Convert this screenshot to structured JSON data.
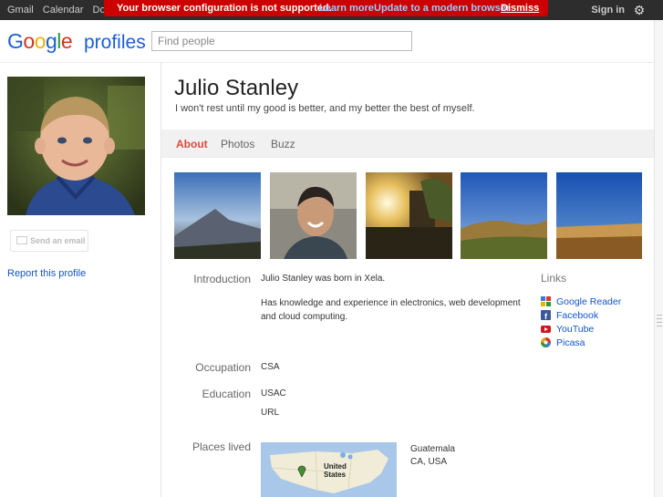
{
  "topbar": {
    "nav": [
      "Gmail",
      "Calendar",
      "Docu"
    ],
    "sign_in": "Sign in",
    "settings_icon": "gear-icon"
  },
  "warning": {
    "message": "Your browser configuration is not supported.",
    "learn_more": "Learn more",
    "update": "Update to a modern browser",
    "dismiss": "Dismiss",
    "color": "#cc0000"
  },
  "header": {
    "logo_text": "Google",
    "product": "profiles",
    "search_placeholder": "Find people"
  },
  "left": {
    "send_email": "Send an email",
    "report": "Report this profile"
  },
  "profile": {
    "name": "Julio Stanley",
    "tagline": "I won't rest until my good is better, and my better the best of myself."
  },
  "tabs": [
    "About",
    "Photos",
    "Buzz"
  ],
  "about": {
    "introduction_label": "Introduction",
    "introduction_1": "Julio Stanley was born in Xela.",
    "introduction_2": "Has knowledge and experience in electronics, web development and cloud computing.",
    "occupation_label": "Occupation",
    "occupation": "CSA",
    "education_label": "Education",
    "education_1": "USAC",
    "education_2": "URL",
    "places_label": "Places lived",
    "places_1": "Guatemala",
    "places_2": "CA, USA",
    "map_label": "United States"
  },
  "links": {
    "title": "Links",
    "items": [
      {
        "label": "Google Reader",
        "icon": "google-reader-icon"
      },
      {
        "label": "Facebook",
        "icon": "facebook-icon"
      },
      {
        "label": "YouTube",
        "icon": "youtube-icon"
      },
      {
        "label": "Picasa",
        "icon": "picasa-icon"
      }
    ]
  },
  "colors": {
    "accent": "#dd4b39",
    "link": "#1155cc"
  }
}
